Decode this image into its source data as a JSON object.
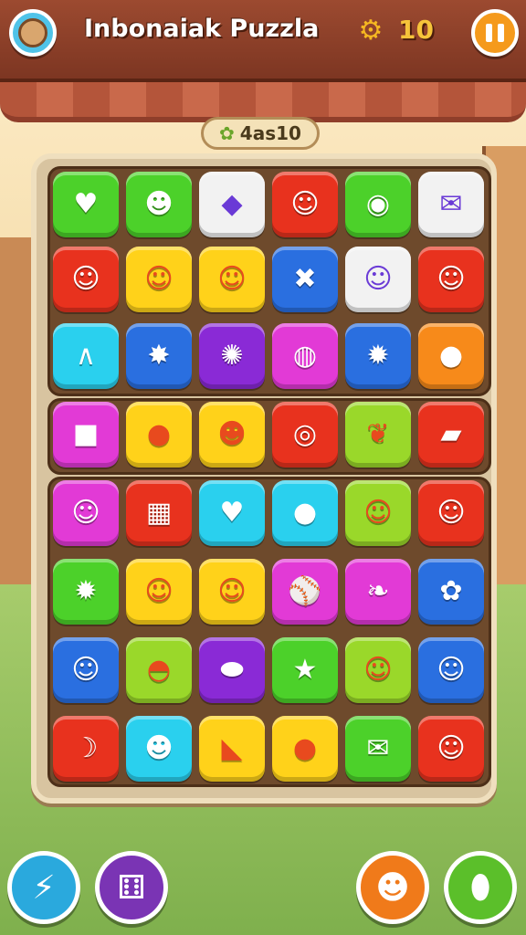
{
  "header": {
    "title": "Inbonaiak Puzzla",
    "coins": "10"
  },
  "score": "4as10",
  "colors": {
    "green": "#4cd12a",
    "lime": "#9ad82a",
    "white": "#f2f2f2",
    "red": "#e8321e",
    "yellow": "#ffd21a",
    "blue": "#2a6fe0",
    "cyan": "#2ad0ee",
    "purple": "#8a2ad6",
    "magenta": "#e23ad6",
    "orange": "#f78a1a"
  },
  "board": {
    "rows": [
      [
        {
          "color": "green",
          "icon": "heart-icon",
          "glyph": "♥"
        },
        {
          "color": "green",
          "icon": "slime-icon",
          "glyph": "☻"
        },
        {
          "color": "white",
          "icon": "gem-icon",
          "glyph": "◆"
        },
        {
          "color": "red",
          "icon": "bear-face-icon",
          "glyph": "☺"
        },
        {
          "color": "green",
          "icon": "eye-icon",
          "glyph": "◉"
        },
        {
          "color": "white",
          "icon": "envelope-icon",
          "glyph": "✉"
        }
      ],
      [
        {
          "color": "red",
          "icon": "devil-face-icon",
          "glyph": "☺"
        },
        {
          "color": "yellow",
          "icon": "bear-face-icon",
          "glyph": "☺"
        },
        {
          "color": "yellow",
          "icon": "cat-face-icon",
          "glyph": "☺"
        },
        {
          "color": "blue",
          "icon": "crossed-sticks-icon",
          "glyph": "✖"
        },
        {
          "color": "white",
          "icon": "fox-face-icon",
          "glyph": "☺"
        },
        {
          "color": "red",
          "icon": "smiley-face-icon",
          "glyph": "☺"
        }
      ],
      [
        {
          "color": "cyan",
          "icon": "tongs-icon",
          "glyph": "∧"
        },
        {
          "color": "blue",
          "icon": "splat-star-icon",
          "glyph": "✸"
        },
        {
          "color": "purple",
          "icon": "virus-icon",
          "glyph": "✺"
        },
        {
          "color": "magenta",
          "icon": "leaf-orb-icon",
          "glyph": "◍"
        },
        {
          "color": "blue",
          "icon": "star-blob-icon",
          "glyph": "✹"
        },
        {
          "color": "orange",
          "icon": "fruit-face-icon",
          "glyph": "●"
        }
      ],
      [
        {
          "color": "magenta",
          "icon": "cube-icon",
          "glyph": "■"
        },
        {
          "color": "yellow",
          "icon": "red-blob-icon",
          "glyph": "●"
        },
        {
          "color": "yellow",
          "icon": "green-slime-icon",
          "glyph": "☻"
        },
        {
          "color": "red",
          "icon": "ring-icon",
          "glyph": "◎"
        },
        {
          "color": "lime",
          "icon": "leaf-icon",
          "glyph": "❦"
        },
        {
          "color": "red",
          "icon": "crayon-icon",
          "glyph": "▰"
        }
      ],
      [
        {
          "color": "magenta",
          "icon": "cat-face-icon",
          "glyph": "☺"
        },
        {
          "color": "red",
          "icon": "calendar-icon",
          "glyph": "▦"
        },
        {
          "color": "cyan",
          "icon": "heart-arrow-icon",
          "glyph": "♥"
        },
        {
          "color": "cyan",
          "icon": "green-blob-icon",
          "glyph": "●"
        },
        {
          "color": "lime",
          "icon": "blue-smiley-icon",
          "glyph": "☺"
        },
        {
          "color": "red",
          "icon": "pig-face-icon",
          "glyph": "☺"
        }
      ],
      [
        {
          "color": "green",
          "icon": "sun-burst-icon",
          "glyph": "✹"
        },
        {
          "color": "yellow",
          "icon": "monkey-face-icon",
          "glyph": "☺"
        },
        {
          "color": "yellow",
          "icon": "devil-face-icon",
          "glyph": "☺"
        },
        {
          "color": "magenta",
          "icon": "bat-ball-icon",
          "glyph": "⚾"
        },
        {
          "color": "magenta",
          "icon": "feather-icon",
          "glyph": "❧"
        },
        {
          "color": "blue",
          "icon": "bush-icon",
          "glyph": "✿"
        }
      ],
      [
        {
          "color": "blue",
          "icon": "fox-face-icon",
          "glyph": "☺"
        },
        {
          "color": "lime",
          "icon": "mushroom-icon",
          "glyph": "◓"
        },
        {
          "color": "purple",
          "icon": "pill-blob-icon",
          "glyph": "⬬"
        },
        {
          "color": "green",
          "icon": "star-icon",
          "glyph": "★"
        },
        {
          "color": "lime",
          "icon": "ghost-icon",
          "glyph": "☺"
        },
        {
          "color": "blue",
          "icon": "blue-smiley-icon",
          "glyph": "☺"
        }
      ],
      [
        {
          "color": "red",
          "icon": "banana-icon",
          "glyph": "☽"
        },
        {
          "color": "cyan",
          "icon": "fish-face-icon",
          "glyph": "☻"
        },
        {
          "color": "yellow",
          "icon": "origami-icon",
          "glyph": "◣"
        },
        {
          "color": "yellow",
          "icon": "blue-blob-icon",
          "glyph": "●"
        },
        {
          "color": "green",
          "icon": "envelope-icon",
          "glyph": "✉"
        },
        {
          "color": "red",
          "icon": "devil-face-icon",
          "glyph": "☺"
        }
      ]
    ]
  },
  "bottom_buttons": [
    {
      "name": "lightning-boost-button",
      "icon": "lightning-icon",
      "glyph": "⚡"
    },
    {
      "name": "shuffle-dice-button",
      "icon": "dice-icon",
      "glyph": "⚅"
    },
    {
      "name": "monster-helper-button",
      "icon": "monster-icon",
      "glyph": "☻"
    },
    {
      "name": "bean-booster-button",
      "icon": "bean-icon",
      "glyph": "⬮"
    }
  ]
}
